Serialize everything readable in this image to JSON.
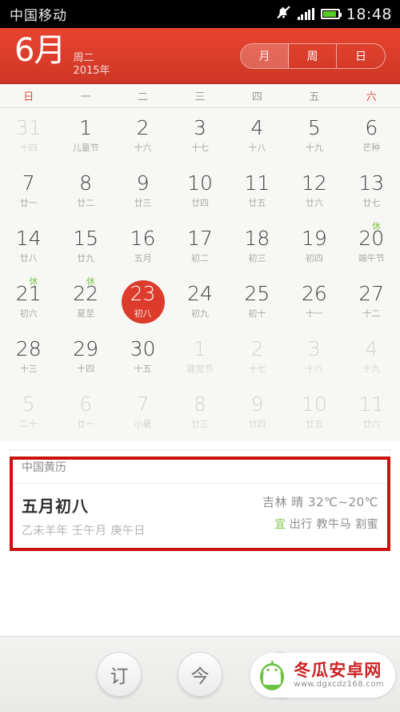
{
  "statusbar": {
    "carrier": "中国移动",
    "clock": "18:48",
    "silent_icon": "bell-muted-icon",
    "signal_icon": "signal-bars-icon",
    "battery_icon": "battery-icon"
  },
  "header": {
    "month": "6月",
    "weekday": "周二",
    "year": "2015年",
    "segments": [
      {
        "label": "月",
        "selected": true
      },
      {
        "label": "周",
        "selected": false
      },
      {
        "label": "日",
        "selected": false
      }
    ]
  },
  "weekdays": [
    {
      "label": "日",
      "weekend": true
    },
    {
      "label": "一",
      "weekend": false
    },
    {
      "label": "二",
      "weekend": false
    },
    {
      "label": "三",
      "weekend": false
    },
    {
      "label": "四",
      "weekend": false
    },
    {
      "label": "五",
      "weekend": false
    },
    {
      "label": "六",
      "weekend": true
    }
  ],
  "calendar": {
    "rows": [
      [
        {
          "day": "31",
          "lunar": "十四",
          "out": true
        },
        {
          "day": "1",
          "lunar": "儿童节",
          "out": false
        },
        {
          "day": "2",
          "lunar": "十六",
          "out": false
        },
        {
          "day": "3",
          "lunar": "十七",
          "out": false
        },
        {
          "day": "4",
          "lunar": "十八",
          "out": false
        },
        {
          "day": "5",
          "lunar": "十九",
          "out": false
        },
        {
          "day": "6",
          "lunar": "芒种",
          "out": false
        }
      ],
      [
        {
          "day": "7",
          "lunar": "廿一",
          "out": false
        },
        {
          "day": "8",
          "lunar": "廿二",
          "out": false
        },
        {
          "day": "9",
          "lunar": "廿三",
          "out": false
        },
        {
          "day": "10",
          "lunar": "廿四",
          "out": false
        },
        {
          "day": "11",
          "lunar": "廿五",
          "out": false
        },
        {
          "day": "12",
          "lunar": "廿六",
          "out": false
        },
        {
          "day": "13",
          "lunar": "廿七",
          "out": false
        }
      ],
      [
        {
          "day": "14",
          "lunar": "廿八",
          "out": false
        },
        {
          "day": "15",
          "lunar": "廿九",
          "out": false
        },
        {
          "day": "16",
          "lunar": "五月",
          "out": false
        },
        {
          "day": "17",
          "lunar": "初二",
          "out": false
        },
        {
          "day": "18",
          "lunar": "初三",
          "out": false
        },
        {
          "day": "19",
          "lunar": "初四",
          "out": false
        },
        {
          "day": "20",
          "lunar": "端午节",
          "out": false,
          "rest": "休"
        }
      ],
      [
        {
          "day": "21",
          "lunar": "初六",
          "out": false,
          "rest": "休"
        },
        {
          "day": "22",
          "lunar": "夏至",
          "out": false,
          "rest": "休"
        },
        {
          "day": "23",
          "lunar": "初八",
          "out": false,
          "selected": true
        },
        {
          "day": "24",
          "lunar": "初九",
          "out": false
        },
        {
          "day": "25",
          "lunar": "初十",
          "out": false
        },
        {
          "day": "26",
          "lunar": "十一",
          "out": false
        },
        {
          "day": "27",
          "lunar": "十二",
          "out": false
        }
      ],
      [
        {
          "day": "28",
          "lunar": "十三",
          "out": false
        },
        {
          "day": "29",
          "lunar": "十四",
          "out": false
        },
        {
          "day": "30",
          "lunar": "十五",
          "out": false
        },
        {
          "day": "1",
          "lunar": "建党节",
          "out": true
        },
        {
          "day": "2",
          "lunar": "十七",
          "out": true
        },
        {
          "day": "3",
          "lunar": "十八",
          "out": true
        },
        {
          "day": "4",
          "lunar": "十九",
          "out": true
        }
      ],
      [
        {
          "day": "5",
          "lunar": "二十",
          "out": true
        },
        {
          "day": "6",
          "lunar": "廿一",
          "out": true
        },
        {
          "day": "7",
          "lunar": "小暑",
          "out": true
        },
        {
          "day": "8",
          "lunar": "廿三",
          "out": true
        },
        {
          "day": "9",
          "lunar": "廿四",
          "out": true
        },
        {
          "day": "10",
          "lunar": "廿五",
          "out": true
        },
        {
          "day": "11",
          "lunar": "廿六",
          "out": true
        }
      ]
    ]
  },
  "almanac": {
    "title": "中国黄历",
    "lunar_date": "五月初八",
    "ganzhi": "乙未羊年 壬午月 庚午日",
    "weather": "吉林 晴 32℃~20℃",
    "yi_tag": "宜",
    "yi_items": "出行 教牛马 割蜜"
  },
  "bottombar": {
    "subscribe_label": "订",
    "today_label": "今",
    "add_label": "+"
  },
  "watermark": {
    "name": "冬瓜安卓网",
    "url": "www.dgxcdz168.com",
    "logo_icon": "android-mascot-icon"
  },
  "colors": {
    "brand_red": "#dd3c2c",
    "header_red": "#e8442f",
    "rest_green": "#7dc242",
    "annotation_red": "#cc1111"
  }
}
